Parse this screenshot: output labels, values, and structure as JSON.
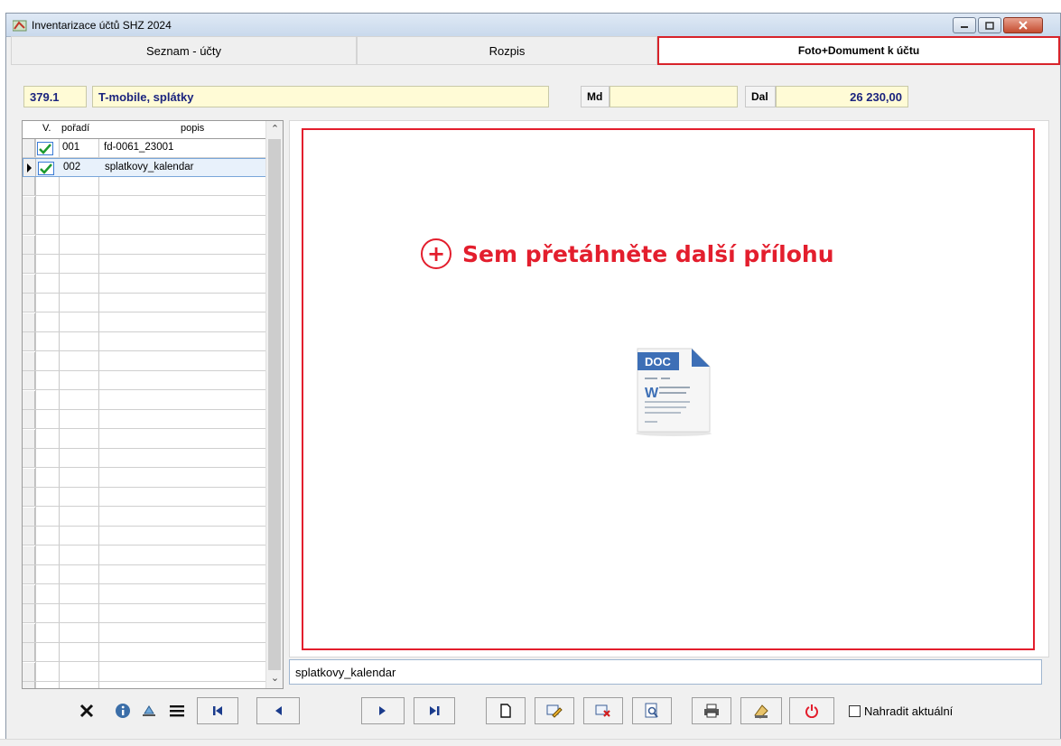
{
  "window": {
    "title": "Inventarizace účtů SHZ 2024"
  },
  "tabs": [
    {
      "label": "Seznam - účty",
      "active": false
    },
    {
      "label": "Rozpis",
      "active": false
    },
    {
      "label": "Foto+Domument k účtu",
      "active": true
    }
  ],
  "account": {
    "code": "379.1",
    "name": "T-mobile, splátky",
    "md_label": "Md",
    "md_value": "",
    "dal_label": "Dal",
    "dal_value": "26 230,00"
  },
  "grid": {
    "columns": [
      "V.",
      "pořadí",
      "popis"
    ],
    "rows": [
      {
        "checked": true,
        "poradi": "001",
        "popis": "fd-0061_23001",
        "selected": false
      },
      {
        "checked": true,
        "poradi": "002",
        "popis": "splatkovy_kalendar",
        "selected": true
      }
    ]
  },
  "preview": {
    "drop_text": "Sem přetáhněte další přílohu",
    "doc_badge": "DOC",
    "doc_letter": "W",
    "filename": "splatkovy_kalendar"
  },
  "toolbar": {
    "replace_label": "Nahradit aktuální",
    "replace_checked": false
  },
  "colors": {
    "accent_red": "#e31e2d",
    "field_yellow": "#fffbd6",
    "text_blue": "#1a237e"
  }
}
